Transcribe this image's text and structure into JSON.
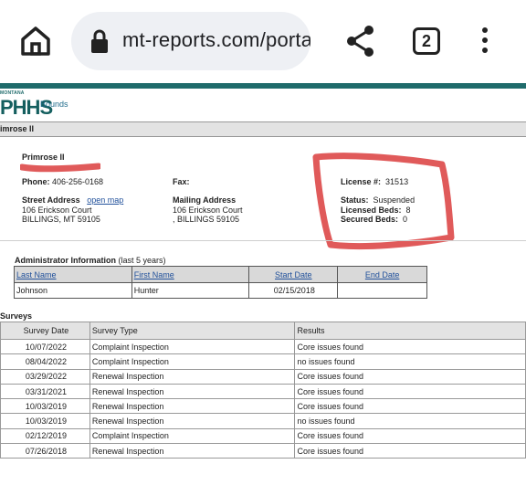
{
  "browser": {
    "url": "mt-reports.com/porta",
    "tab_count": "2"
  },
  "site": {
    "logo_small": "MONTANA",
    "logo_big": "PHHS",
    "bounds_link": "Bounds"
  },
  "facility": {
    "bar_title": "imrose II",
    "name": "Primrose II",
    "phone_label": "Phone:",
    "phone": "406-256-0168",
    "fax_label": "Fax:",
    "street_label": "Street Address",
    "open_map": "open map",
    "street_line1": "106 Erickson Court",
    "street_line2": "BILLINGS, MT 59105",
    "mailing_label": "Mailing Address",
    "mailing_line1": "106 Erickson Court",
    "mailing_line2": ", BILLINGS 59105",
    "license_label": "License #:",
    "license": "31513",
    "status_label": "Status:",
    "status": "Suspended",
    "licensed_beds_label": "Licensed Beds:",
    "licensed_beds": "8",
    "secured_beds_label": "Secured Beds:",
    "secured_beds": "0"
  },
  "admin": {
    "title_bold": "Administrator Information",
    "title_rest": " (last 5 years)",
    "headers": [
      "Last Name",
      "First Name",
      "Start Date",
      "End Date"
    ],
    "rows": [
      [
        "Johnson",
        "Hunter",
        "02/15/2018",
        ""
      ]
    ]
  },
  "surveys": {
    "title": "Surveys",
    "headers": [
      "Survey Date",
      "Survey Type",
      "Results"
    ],
    "rows": [
      [
        "10/07/2022",
        "Complaint Inspection",
        "Core issues found"
      ],
      [
        "08/04/2022",
        "Complaint Inspection",
        "no issues found"
      ],
      [
        "03/29/2022",
        "Renewal Inspection",
        "Core issues found"
      ],
      [
        "03/31/2021",
        "Renewal Inspection",
        "Core issues found"
      ],
      [
        "10/03/2019",
        "Renewal Inspection",
        "Core issues found"
      ],
      [
        "10/03/2019",
        "Renewal Inspection",
        "no issues found"
      ],
      [
        "02/12/2019",
        "Complaint Inspection",
        "Core issues found"
      ],
      [
        "07/26/2018",
        "Renewal Inspection",
        "Core issues found"
      ]
    ]
  },
  "colors": {
    "teal": "#1f6b6b",
    "annotation_red": "#e05a5a"
  }
}
